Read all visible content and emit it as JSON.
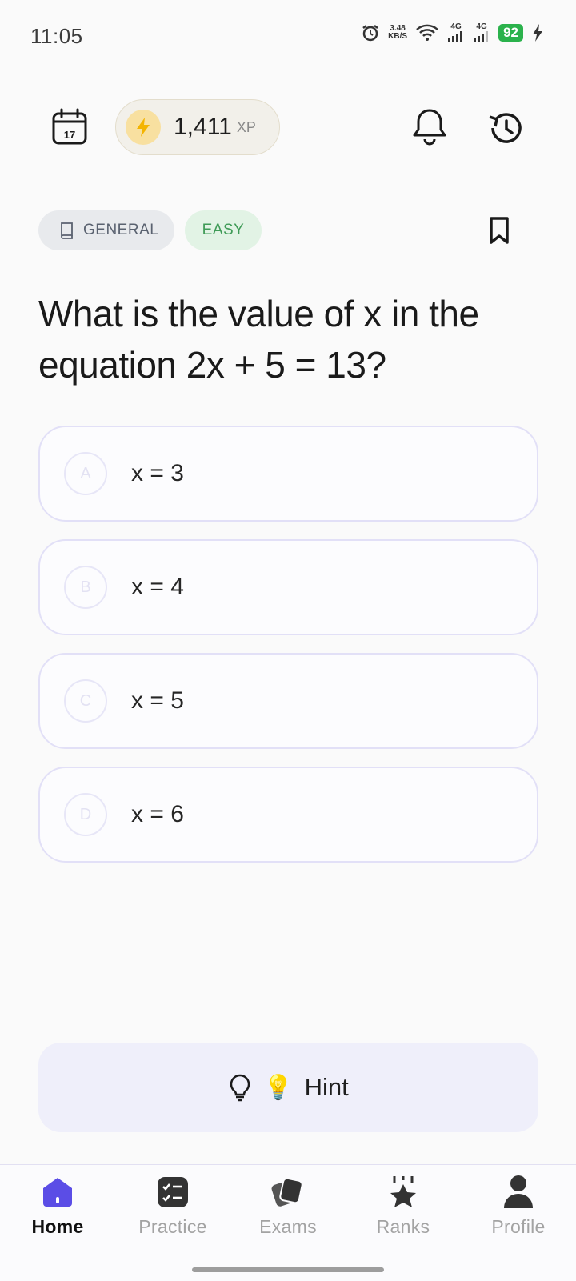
{
  "status_bar": {
    "time": "11:05",
    "net_speed_value": "3.48",
    "net_speed_unit": "KB/S",
    "signal_1_label": "4G",
    "signal_2_label": "4G",
    "battery": "92",
    "icons": [
      "alarm-icon",
      "wifi-icon",
      "signal-icon",
      "signal-icon",
      "battery-icon",
      "charging-icon"
    ]
  },
  "header": {
    "xp_value": "1,411",
    "xp_unit": "XP",
    "calendar_day": "17",
    "icons": [
      "calendar-icon",
      "bolt-icon",
      "bell-icon",
      "history-icon"
    ]
  },
  "tags": {
    "category": "GENERAL",
    "difficulty": "EASY"
  },
  "question": {
    "text": "What is the value of x in the equation 2x + 5 = 13?"
  },
  "options": [
    {
      "letter": "A",
      "text": "x = 3"
    },
    {
      "letter": "B",
      "text": "x = 4"
    },
    {
      "letter": "C",
      "text": "x = 5"
    },
    {
      "letter": "D",
      "text": "x = 6"
    }
  ],
  "hint": {
    "emoji": "💡",
    "label": "Hint"
  },
  "nav": {
    "items": [
      {
        "label": "Home",
        "icon": "home-icon",
        "active": true
      },
      {
        "label": "Practice",
        "icon": "practice-icon",
        "active": false
      },
      {
        "label": "Exams",
        "icon": "exams-icon",
        "active": false
      },
      {
        "label": "Ranks",
        "icon": "ranks-icon",
        "active": false
      },
      {
        "label": "Profile",
        "icon": "profile-icon",
        "active": false
      }
    ]
  },
  "colors": {
    "accent": "#5b4de6",
    "easy_green": "#3f9b57",
    "battery_green": "#2bb24c",
    "option_border": "#e2e0f7"
  }
}
